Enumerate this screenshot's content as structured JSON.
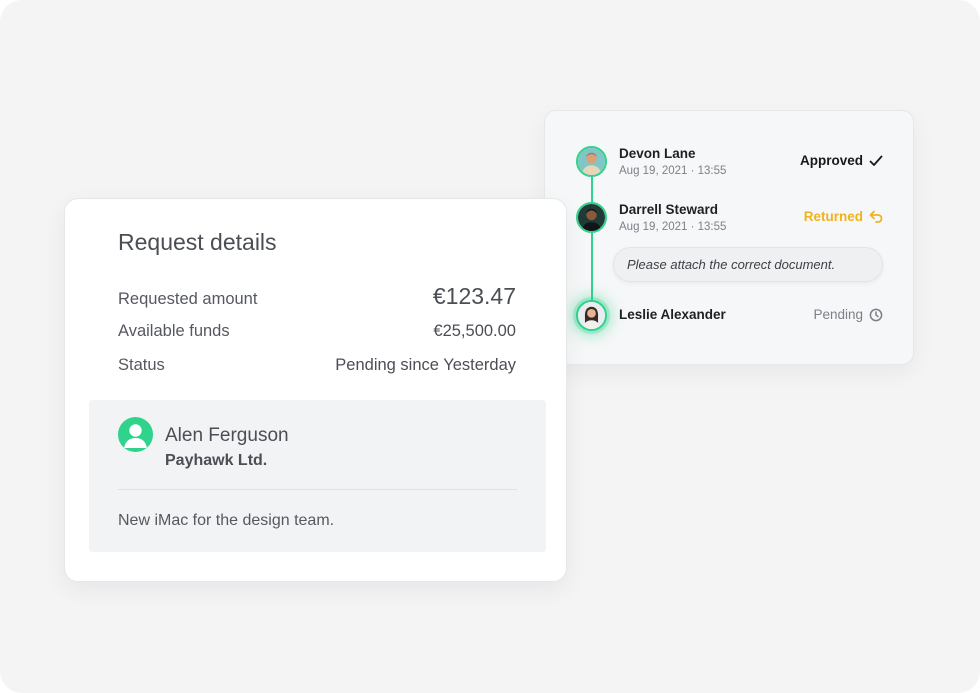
{
  "request_details": {
    "title": "Request details",
    "rows": [
      {
        "label": "Requested amount",
        "value": "€123.47"
      },
      {
        "label": "Available funds",
        "value": "€25,500.00"
      },
      {
        "label": "Status",
        "value": "Pending since Yesterday"
      }
    ],
    "requester": {
      "avatar_icon": "user-icon",
      "name": "Alen Ferguson",
      "company": "Payhawk Ltd.",
      "note": "New iMac for the design team."
    }
  },
  "approvals": {
    "accent_color": "#2fd38c",
    "items": [
      {
        "name": "Devon Lane",
        "time": "Aug 19, 2021 · 13:55",
        "status": "Approved",
        "status_icon": "checkmark-icon",
        "status_color": "#17191c"
      },
      {
        "name": "Darrell Steward",
        "time": "Aug 19, 2021 · 13:55",
        "status": "Returned",
        "status_icon": "return-arrow-icon",
        "status_color": "#f2b21a",
        "comment": "Please attach the correct document."
      },
      {
        "name": "Leslie Alexander",
        "status": "Pending",
        "status_icon": "clock-icon",
        "status_color": "#7c8188"
      }
    ]
  }
}
